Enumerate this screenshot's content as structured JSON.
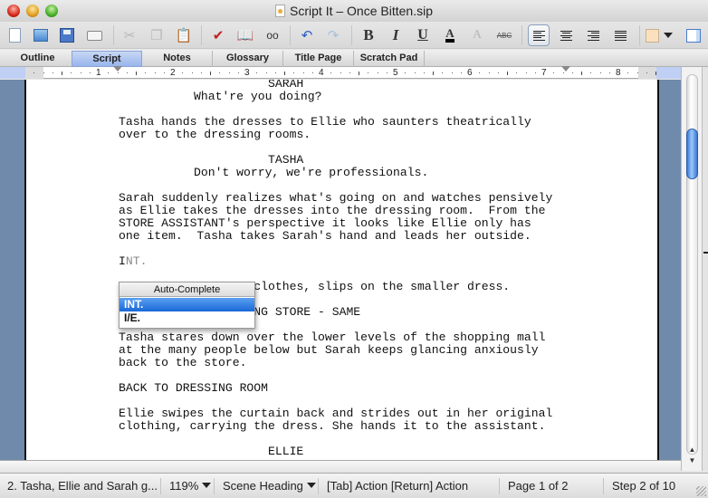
{
  "window": {
    "title": "Script It – Once Bitten.sip"
  },
  "toolbar": {
    "buttons": [
      {
        "name": "new-document",
        "tooltip": "New"
      },
      {
        "name": "open",
        "tooltip": "Open"
      },
      {
        "name": "save",
        "tooltip": "Save"
      },
      {
        "name": "print",
        "tooltip": "Print"
      },
      {
        "name": "cut",
        "tooltip": "Cut",
        "enabled": false
      },
      {
        "name": "copy",
        "tooltip": "Copy",
        "enabled": false
      },
      {
        "name": "paste",
        "tooltip": "Paste"
      },
      {
        "name": "spell-check",
        "tooltip": "Spelling"
      },
      {
        "name": "dictionary",
        "tooltip": "Dictionary"
      },
      {
        "name": "find",
        "tooltip": "Find"
      },
      {
        "name": "undo",
        "tooltip": "Undo"
      },
      {
        "name": "redo",
        "tooltip": "Redo",
        "enabled": false
      },
      {
        "name": "bold",
        "glyph": "B"
      },
      {
        "name": "italic",
        "glyph": "I"
      },
      {
        "name": "underline",
        "glyph": "U"
      },
      {
        "name": "text-color",
        "glyph": "A"
      },
      {
        "name": "clear-format",
        "glyph": "A"
      },
      {
        "name": "strikethrough",
        "glyph": "ABC"
      },
      {
        "name": "align-left",
        "selected": true
      },
      {
        "name": "align-center"
      },
      {
        "name": "align-right"
      },
      {
        "name": "justify"
      },
      {
        "name": "background-color",
        "color": "#fbe0c0"
      },
      {
        "name": "toggle-panel"
      }
    ]
  },
  "tabs": [
    {
      "label": "Outline",
      "active": false
    },
    {
      "label": "Script",
      "active": true
    },
    {
      "label": "Notes",
      "active": false
    },
    {
      "label": "Glossary",
      "active": false
    },
    {
      "label": "Title Page",
      "active": false
    },
    {
      "label": "Scratch Pad",
      "active": false
    }
  ],
  "ruler": {
    "numbers": [
      "1",
      "2",
      "3",
      "4",
      "5",
      "6",
      "7",
      "8"
    ]
  },
  "script": {
    "lines": [
      {
        "type": "character",
        "text": "SARAH"
      },
      {
        "type": "dialogue",
        "text": "What're you doing?"
      },
      {
        "type": "blank",
        "text": ""
      },
      {
        "type": "action",
        "text": "Tasha hands the dresses to Ellie who saunters theatrically"
      },
      {
        "type": "action",
        "text": "over to the dressing rooms."
      },
      {
        "type": "blank",
        "text": ""
      },
      {
        "type": "character",
        "text": "TASHA"
      },
      {
        "type": "dialogue",
        "text": "Don't worry, we're professionals."
      },
      {
        "type": "blank",
        "text": ""
      },
      {
        "type": "action",
        "text": "Sarah suddenly realizes what's going on and watches pensively"
      },
      {
        "type": "action",
        "text": "as Ellie takes the dresses into the dressing room.  From the"
      },
      {
        "type": "action",
        "text": "STORE ASSISTANT's perspective it looks like Ellie only has"
      },
      {
        "type": "action",
        "text": "one item.  Tasha takes Sarah's hand and leads her outside."
      },
      {
        "type": "blank",
        "text": ""
      },
      {
        "type": "scene-heading-typing",
        "typed": "I",
        "suggestion": "NT."
      },
      {
        "type": "blank",
        "text": ""
      },
      {
        "type": "action",
        "text": "E                  clothes, slips on the smaller dress."
      },
      {
        "type": "blank",
        "text": ""
      },
      {
        "type": "scene-heading",
        "text": "I                  NG STORE - SAME"
      },
      {
        "type": "blank",
        "text": ""
      },
      {
        "type": "action",
        "text": "Tasha stares down over the lower levels of the shopping mall"
      },
      {
        "type": "action",
        "text": "at the many people below but Sarah keeps glancing anxiously"
      },
      {
        "type": "action",
        "text": "back to the store."
      },
      {
        "type": "blank",
        "text": ""
      },
      {
        "type": "scene-heading",
        "text": "BACK TO DRESSING ROOM"
      },
      {
        "type": "blank",
        "text": ""
      },
      {
        "type": "action",
        "text": "Ellie swipes the curtain back and strides out in her original"
      },
      {
        "type": "action",
        "text": "clothing, carrying the dress. She hands it to the assistant."
      },
      {
        "type": "blank",
        "text": ""
      },
      {
        "type": "character",
        "text": "ELLIE"
      }
    ]
  },
  "autocomplete": {
    "title": "Auto-Complete",
    "options": [
      {
        "label": "INT.",
        "selected": true
      },
      {
        "label": "I/E.",
        "selected": false
      }
    ]
  },
  "statusbar": {
    "scene": "2.  Tasha, Ellie and Sarah g...",
    "zoom": "119%",
    "element_type": "Scene Heading",
    "keys_hint": "[Tab] Action  [Return] Action",
    "page": "Page 1 of 2",
    "step": "Step 2 of 10"
  },
  "colors": {
    "accent": "#1a68d8",
    "gutter": "#6f8aab",
    "tab_active": "#98b4ec"
  }
}
